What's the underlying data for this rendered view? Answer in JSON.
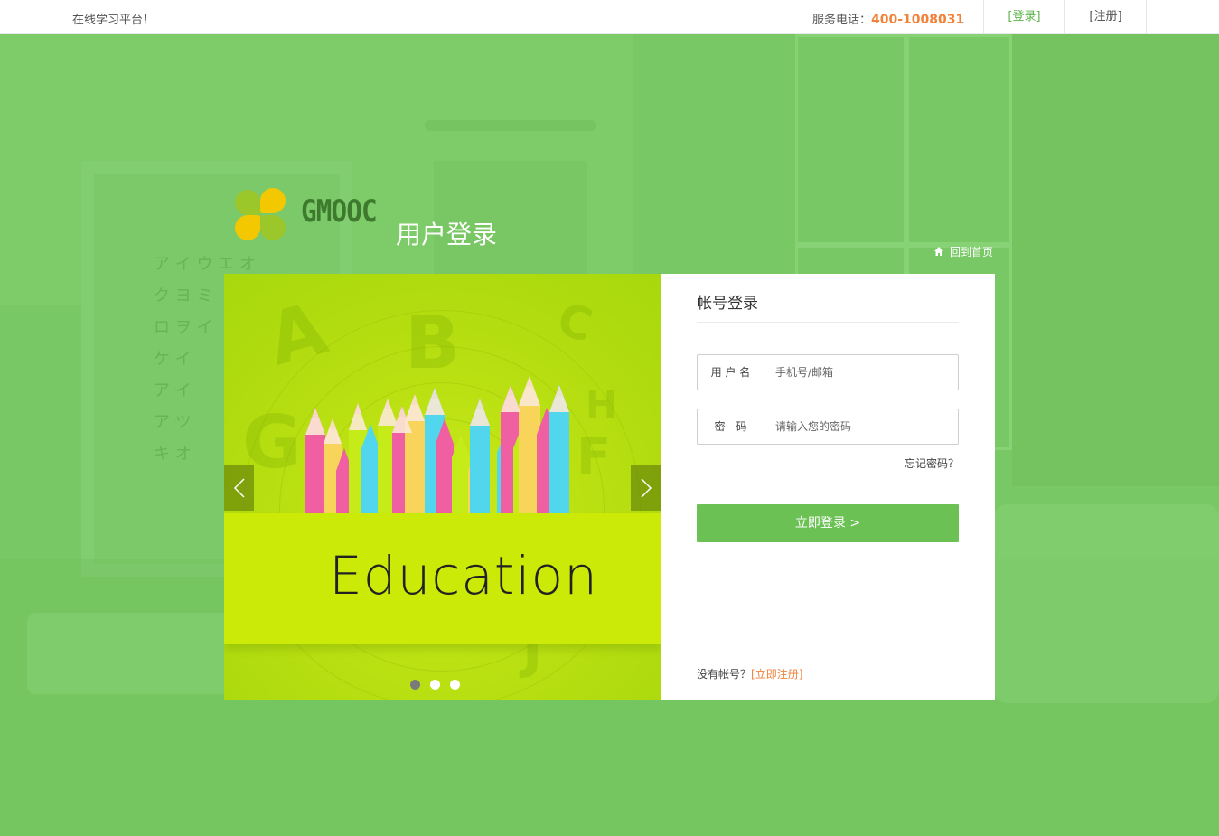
{
  "topbar": {
    "slogan": "在线学习平台！",
    "service_label": "服务电话：",
    "service_phone": "400-1008031",
    "login": "[登录]",
    "register": "[注册]"
  },
  "header": {
    "brand": "GMOOC",
    "title": "用户登录",
    "home_link": "回到首页"
  },
  "carousel": {
    "caption": "Education",
    "slides": 3,
    "active_slide": 1
  },
  "login": {
    "heading": "帐号登录",
    "username_label": "用 户 名",
    "username_placeholder": "手机号/邮箱",
    "password_label": "密　码",
    "password_placeholder": "请输入您的密码",
    "forgot": "忘记密码？",
    "submit": "立即登录 >",
    "no_account": "没有帐号？",
    "register_now": "[立即注册]"
  },
  "colors": {
    "accent": "#6cc154",
    "phone": "#f0823a",
    "background": "#78c965"
  }
}
